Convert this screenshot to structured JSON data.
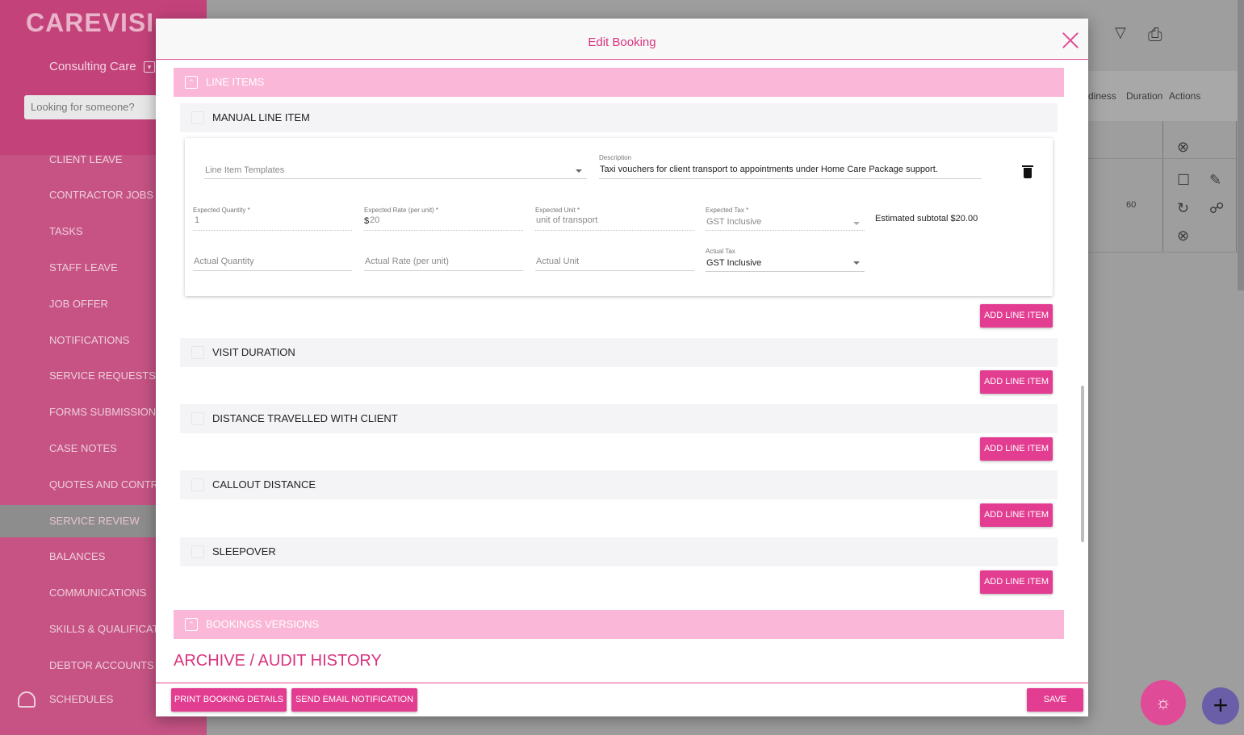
{
  "app": {
    "logo": "CAREVISI",
    "org_name": "Consulting Care",
    "search_placeholder": "Looking for someone?",
    "nav": [
      {
        "label": "CLIENT LEAVE"
      },
      {
        "label": "CONTRACTOR JOBS"
      },
      {
        "label": "TASKS"
      },
      {
        "label": "STAFF LEAVE"
      },
      {
        "label": "JOB OFFER"
      },
      {
        "label": "NOTIFICATIONS"
      },
      {
        "label": "SERVICE REQUESTS"
      },
      {
        "label": "FORMS SUBMISSIONS"
      },
      {
        "label": "CASE NOTES"
      },
      {
        "label": "QUOTES AND CONTRA"
      },
      {
        "label": "SERVICE REVIEW"
      },
      {
        "label": "BALANCES"
      },
      {
        "label": "COMMUNICATIONS"
      },
      {
        "label": "SKILLS & QUALIFICATI"
      },
      {
        "label": "DEBTOR ACCOUNTS"
      },
      {
        "label": "SCHEDULES"
      }
    ],
    "table_columns": [
      "diness",
      "Duration",
      "Actions"
    ],
    "duration_value": "60"
  },
  "modal": {
    "title": "Edit Booking",
    "sections": {
      "line_items": "LINE ITEMS",
      "bookings_versions": "BOOKINGS VERSIONS"
    },
    "groups": [
      {
        "label": "MANUAL LINE ITEM"
      },
      {
        "label": "VISIT DURATION"
      },
      {
        "label": "DISTANCE TRAVELLED WITH CLIENT"
      },
      {
        "label": "CALLOUT DISTANCE"
      },
      {
        "label": "SLEEPOVER"
      }
    ],
    "line_item": {
      "template_placeholder": "Line Item Templates",
      "description_label": "Description",
      "description_value": "Taxi vouchers for client transport to appointments under Home Care Package support.",
      "expected_quantity_label": "Expected Quantity *",
      "expected_quantity_value": "1",
      "expected_rate_label": "Expected Rate (per unit) *",
      "expected_rate_prefix": "$",
      "expected_rate_value": "20",
      "expected_unit_label": "Expected Unit *",
      "expected_unit_value": "unit of transport",
      "expected_tax_label": "Expected Tax *",
      "expected_tax_value": "GST Inclusive",
      "estimated_subtotal": "Estimated subtotal $20.00",
      "actual_quantity_placeholder": "Actual Quantity",
      "actual_rate_placeholder": "Actual Rate (per unit)",
      "actual_unit_placeholder": "Actual Unit",
      "actual_tax_label": "Actual Tax",
      "actual_tax_value": "GST Inclusive"
    },
    "add_line_item_label": "ADD LINE ITEM",
    "audit_heading": "ARCHIVE / AUDIT HISTORY",
    "footer": {
      "print_label": "PRINT BOOKING DETAILS",
      "email_label": "SEND EMAIL NOTIFICATION",
      "save_label": "SAVE"
    }
  },
  "colors": {
    "accent": "#e23d91",
    "section_bar": "#fbb7d8",
    "sidebar": "#c65384"
  }
}
